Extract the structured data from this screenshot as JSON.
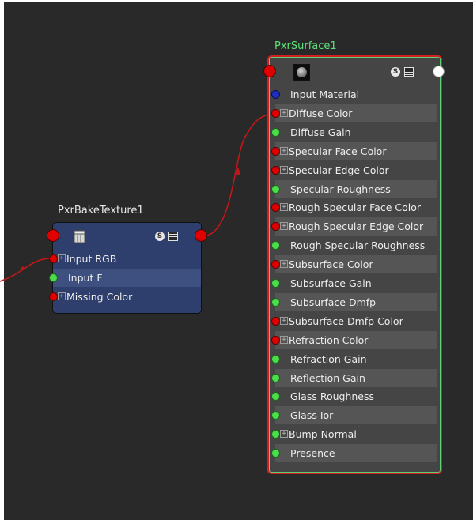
{
  "nodes": {
    "surface": {
      "title": "PxrSurface1",
      "shader_icon": "sphere-icon",
      "s_label": "S",
      "attributes": [
        {
          "label": "Input Material",
          "plug": "blue",
          "expandable": false
        },
        {
          "label": "Diffuse Color",
          "plug": "red",
          "expandable": true
        },
        {
          "label": "Diffuse Gain",
          "plug": "green",
          "expandable": false
        },
        {
          "label": "Specular Face Color",
          "plug": "red",
          "expandable": true
        },
        {
          "label": "Specular Edge Color",
          "plug": "red",
          "expandable": true
        },
        {
          "label": "Specular Roughness",
          "plug": "green",
          "expandable": false
        },
        {
          "label": "Rough Specular Face Color",
          "plug": "red",
          "expandable": true
        },
        {
          "label": "Rough Specular Edge Color",
          "plug": "red",
          "expandable": true
        },
        {
          "label": "Rough Specular Roughness",
          "plug": "green",
          "expandable": false
        },
        {
          "label": "Subsurface Color",
          "plug": "red",
          "expandable": true
        },
        {
          "label": "Subsurface Gain",
          "plug": "green",
          "expandable": false
        },
        {
          "label": "Subsurface Dmfp",
          "plug": "green",
          "expandable": false
        },
        {
          "label": "Subsurface Dmfp Color",
          "plug": "red",
          "expandable": true
        },
        {
          "label": "Refraction Color",
          "plug": "red",
          "expandable": true
        },
        {
          "label": "Refraction Gain",
          "plug": "green",
          "expandable": false
        },
        {
          "label": "Reflection Gain",
          "plug": "green",
          "expandable": false
        },
        {
          "label": "Glass Roughness",
          "plug": "green",
          "expandable": false
        },
        {
          "label": "Glass Ior",
          "plug": "green",
          "expandable": false
        },
        {
          "label": "Bump Normal",
          "plug": "green",
          "expandable": true
        },
        {
          "label": "Presence",
          "plug": "green",
          "expandable": false
        }
      ]
    },
    "bake": {
      "title": "PxrBakeTexture1",
      "shader_icon": "texture-icon",
      "s_label": "S",
      "attributes": [
        {
          "label": "Input RGB",
          "plug": "red",
          "expandable": true
        },
        {
          "label": "Input F",
          "plug": "green",
          "expandable": false
        },
        {
          "label": "Missing Color",
          "plug": "red",
          "expandable": true
        }
      ]
    }
  },
  "colors": {
    "canvas": "#292929",
    "wire": "#c01818",
    "selected_outline": "#5fd07a",
    "plug_color": "#e00000",
    "plug_float": "#4cdc4c",
    "plug_material": "#1e2fbe"
  }
}
